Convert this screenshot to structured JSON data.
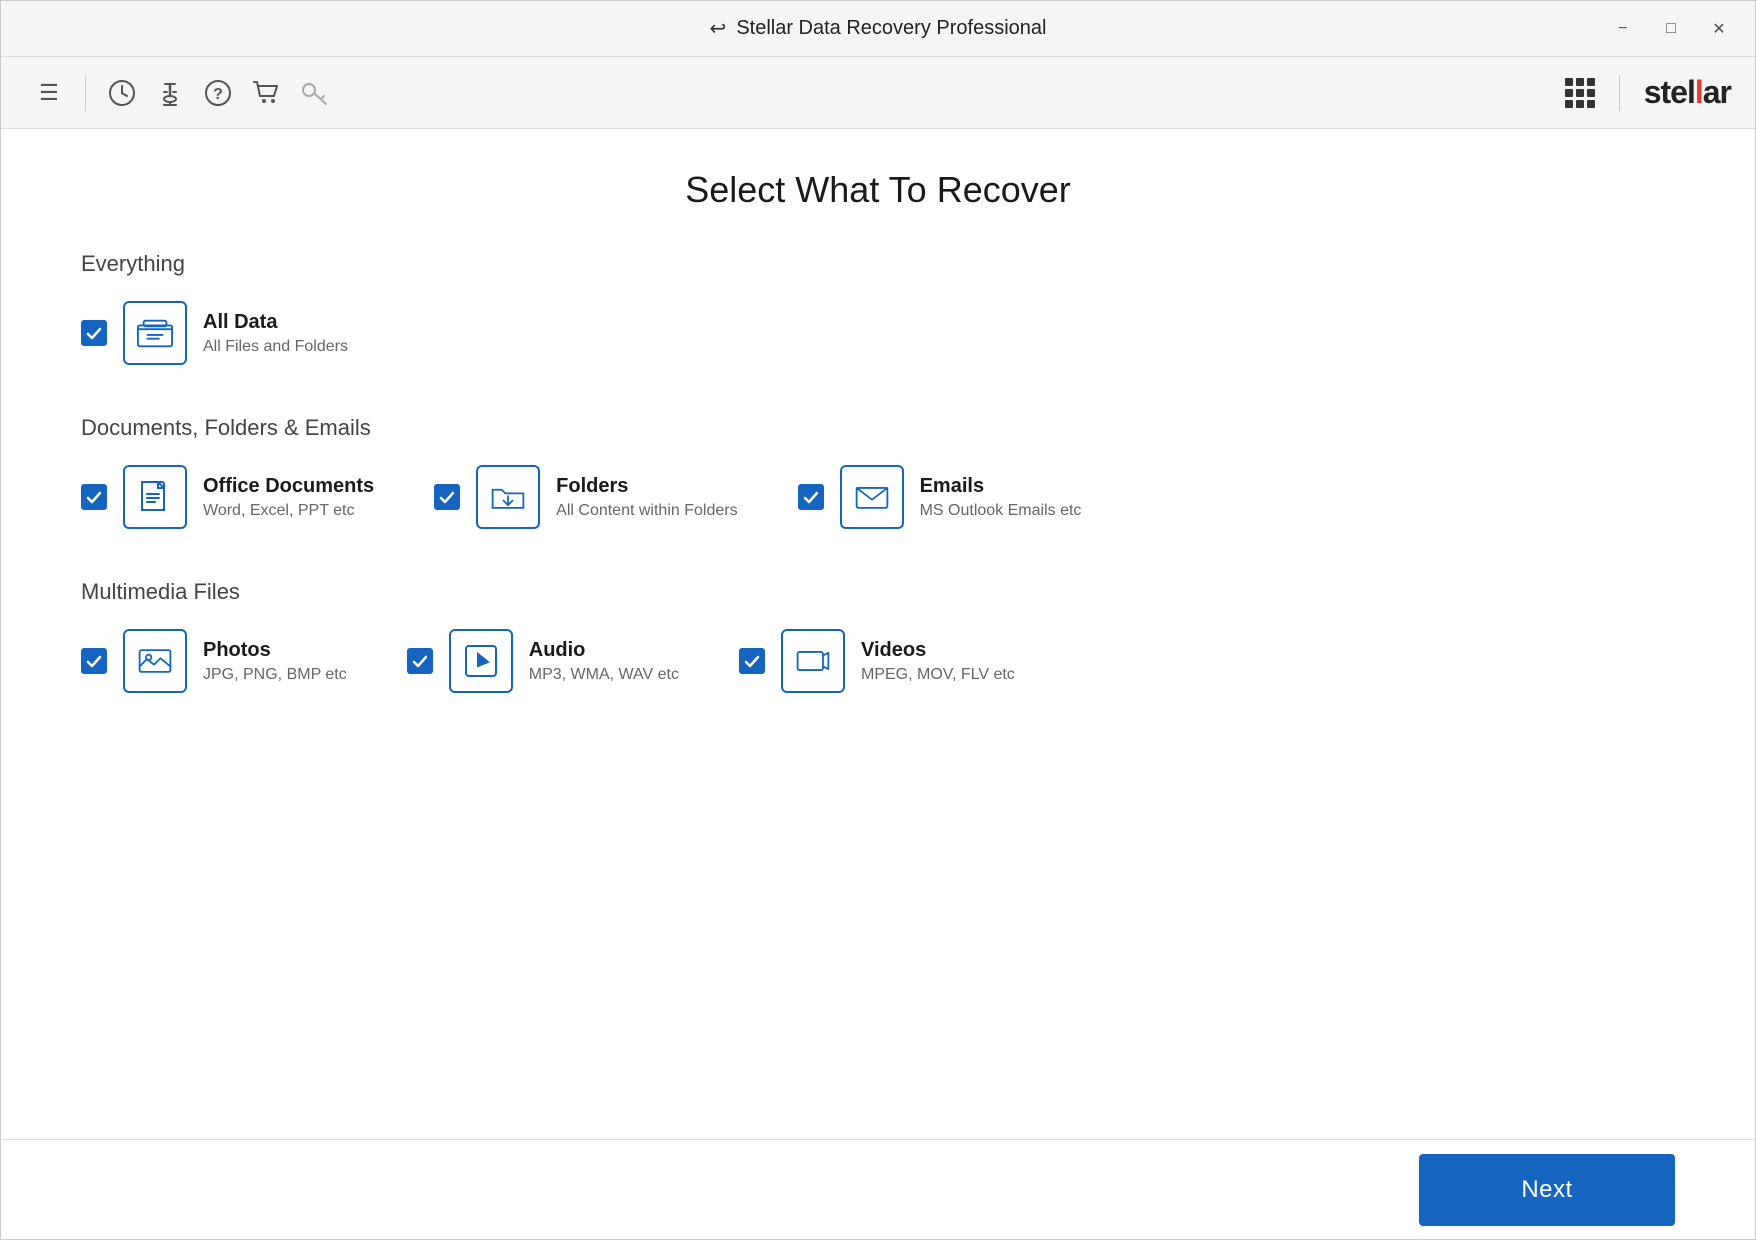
{
  "titlebar": {
    "title": "Stellar Data Recovery Professional",
    "minimize_label": "−",
    "restore_label": "□",
    "close_label": "✕"
  },
  "toolbar": {
    "menu_icon": "☰",
    "icons": [
      {
        "name": "history-icon",
        "symbol": "◷"
      },
      {
        "name": "scan-icon",
        "symbol": "🔬"
      },
      {
        "name": "help-icon",
        "symbol": "?"
      },
      {
        "name": "cart-icon",
        "symbol": "🛒"
      },
      {
        "name": "key-icon",
        "symbol": "🔑"
      }
    ]
  },
  "brand": {
    "text_black": "stel",
    "text_red": "l",
    "text_black2": "ar"
  },
  "page": {
    "title": "Select What To Recover"
  },
  "sections": [
    {
      "id": "everything",
      "label": "Everything",
      "options": [
        {
          "id": "all-data",
          "title": "All Data",
          "subtitle": "All Files and Folders",
          "checked": true,
          "icon_type": "alldata"
        }
      ]
    },
    {
      "id": "documents",
      "label": "Documents, Folders & Emails",
      "options": [
        {
          "id": "office-docs",
          "title": "Office Documents",
          "subtitle": "Word, Excel, PPT etc",
          "checked": true,
          "icon_type": "document"
        },
        {
          "id": "folders",
          "title": "Folders",
          "subtitle": "All Content within Folders",
          "checked": true,
          "icon_type": "folder"
        },
        {
          "id": "emails",
          "title": "Emails",
          "subtitle": "MS Outlook Emails etc",
          "checked": true,
          "icon_type": "email"
        }
      ]
    },
    {
      "id": "multimedia",
      "label": "Multimedia Files",
      "options": [
        {
          "id": "photos",
          "title": "Photos",
          "subtitle": "JPG, PNG, BMP etc",
          "checked": true,
          "icon_type": "photo"
        },
        {
          "id": "audio",
          "title": "Audio",
          "subtitle": "MP3, WMA, WAV etc",
          "checked": true,
          "icon_type": "audio"
        },
        {
          "id": "videos",
          "title": "Videos",
          "subtitle": "MPEG, MOV, FLV etc",
          "checked": true,
          "icon_type": "video"
        }
      ]
    }
  ],
  "footer": {
    "next_label": "Next"
  }
}
